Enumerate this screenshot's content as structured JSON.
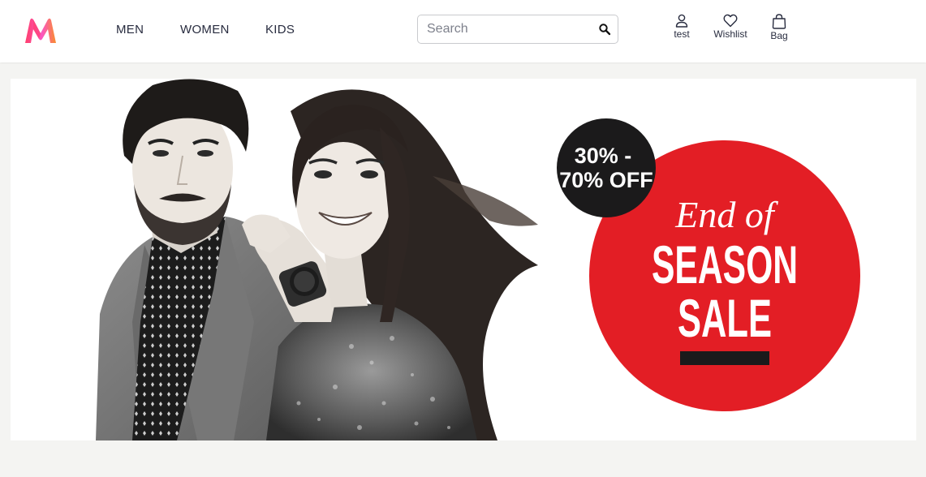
{
  "header": {
    "logo_icon": "myntra-logo-icon",
    "nav": [
      {
        "label": "MEN"
      },
      {
        "label": "WOMEN"
      },
      {
        "label": "KIDS"
      }
    ],
    "search": {
      "placeholder": "Search",
      "value": "",
      "icon": "search-icon"
    },
    "actions": {
      "profile": {
        "label": "test",
        "icon": "user-icon"
      },
      "wishlist": {
        "label": "Wishlist",
        "icon": "heart-icon"
      },
      "bag": {
        "label": "Bag",
        "icon": "bag-icon"
      }
    }
  },
  "banner": {
    "discount_line1": "30% -",
    "discount_line2": "70% OFF",
    "script_text": "End of",
    "headline_line1": "SEASON",
    "headline_line2": "SALE"
  },
  "colors": {
    "sale_red": "#e31e25",
    "badge_black": "#1b1a1b",
    "logo_pink": "#ff3f6c",
    "logo_orange": "#f98d2c",
    "text_dark": "#282c3f",
    "page_bg": "#f4f4f2"
  }
}
